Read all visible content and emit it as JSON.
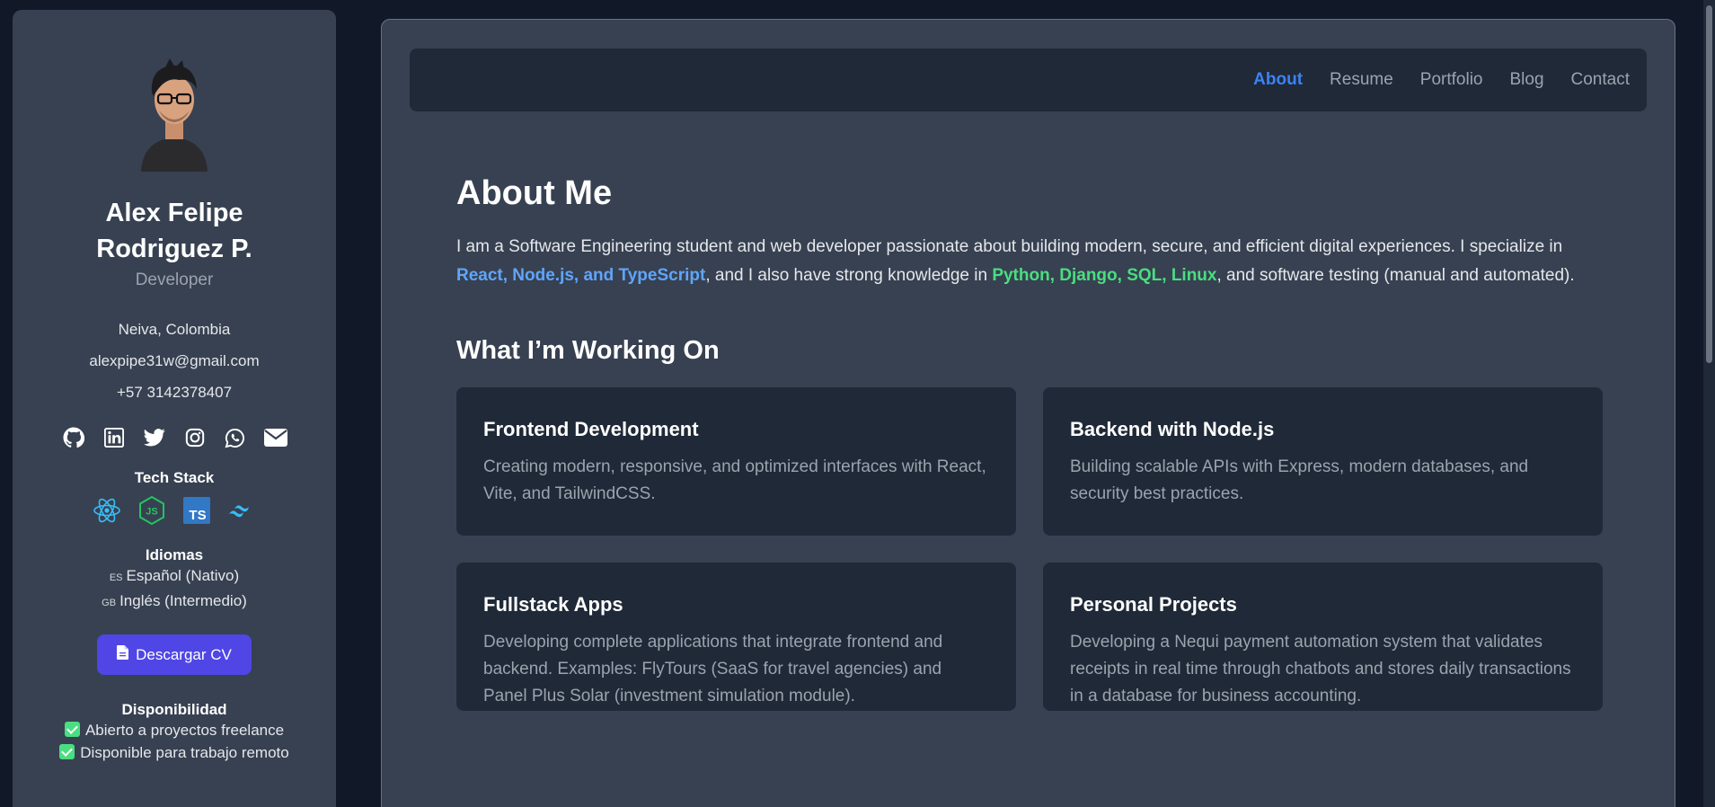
{
  "profile": {
    "name": "Alex Felipe Rodriguez P.",
    "role": "Developer",
    "location": "Neiva, Colombia",
    "email": "alexpipe31w@gmail.com",
    "phone": "+57 3142378407"
  },
  "socials": [
    "github-icon",
    "linkedin-icon",
    "twitter-icon",
    "instagram-icon",
    "whatsapp-icon",
    "email-icon"
  ],
  "tech_stack": {
    "title": "Tech Stack",
    "items": [
      "react-icon",
      "nodejs-icon",
      "typescript-icon",
      "tailwindcss-icon"
    ]
  },
  "languages": {
    "title": "Idiomas",
    "items": [
      {
        "flag": "ES",
        "label": "Español (Nativo)"
      },
      {
        "flag": "GB",
        "label": "Inglés (Intermedio)"
      }
    ]
  },
  "cv_button": "Descargar CV",
  "availability": {
    "title": "Disponibilidad",
    "items": [
      "Abierto a proyectos freelance",
      "Disponible para trabajo remoto"
    ]
  },
  "nav": {
    "items": [
      "About",
      "Resume",
      "Portfolio",
      "Blog",
      "Contact"
    ],
    "active": "About"
  },
  "about": {
    "title": "About Me",
    "p_start": "I am a Software Engineering student and web developer passionate about building modern, secure, and efficient digital experiences. I specialize in ",
    "hl1": "React, Node.js, and TypeScript",
    "p_mid": ", and I also have strong knowledge in ",
    "hl2": "Python, Django, SQL, Linux",
    "p_end": ", and software testing (manual and automated)."
  },
  "working": {
    "title": "What I’m Working On",
    "cards": [
      {
        "title": "Frontend Development",
        "desc": "Creating modern, responsive, and optimized interfaces with React, Vite, and TailwindCSS."
      },
      {
        "title": "Backend with Node.js",
        "desc": "Building scalable APIs with Express, modern databases, and security best practices."
      },
      {
        "title": "Fullstack Apps",
        "desc": "Developing complete applications that integrate frontend and backend. Examples: FlyTours (SaaS for travel agencies) and Panel Plus Solar (investment simulation module)."
      },
      {
        "title": "Personal Projects",
        "desc": "Developing a Nequi payment automation system that validates receipts in real time through chatbots and stores daily transactions in a database for business accounting."
      }
    ]
  },
  "colors": {
    "accent": "#3b82f6",
    "highlight_blue": "#60a5fa",
    "highlight_green": "#4ade80",
    "button": "#4f46e5"
  }
}
